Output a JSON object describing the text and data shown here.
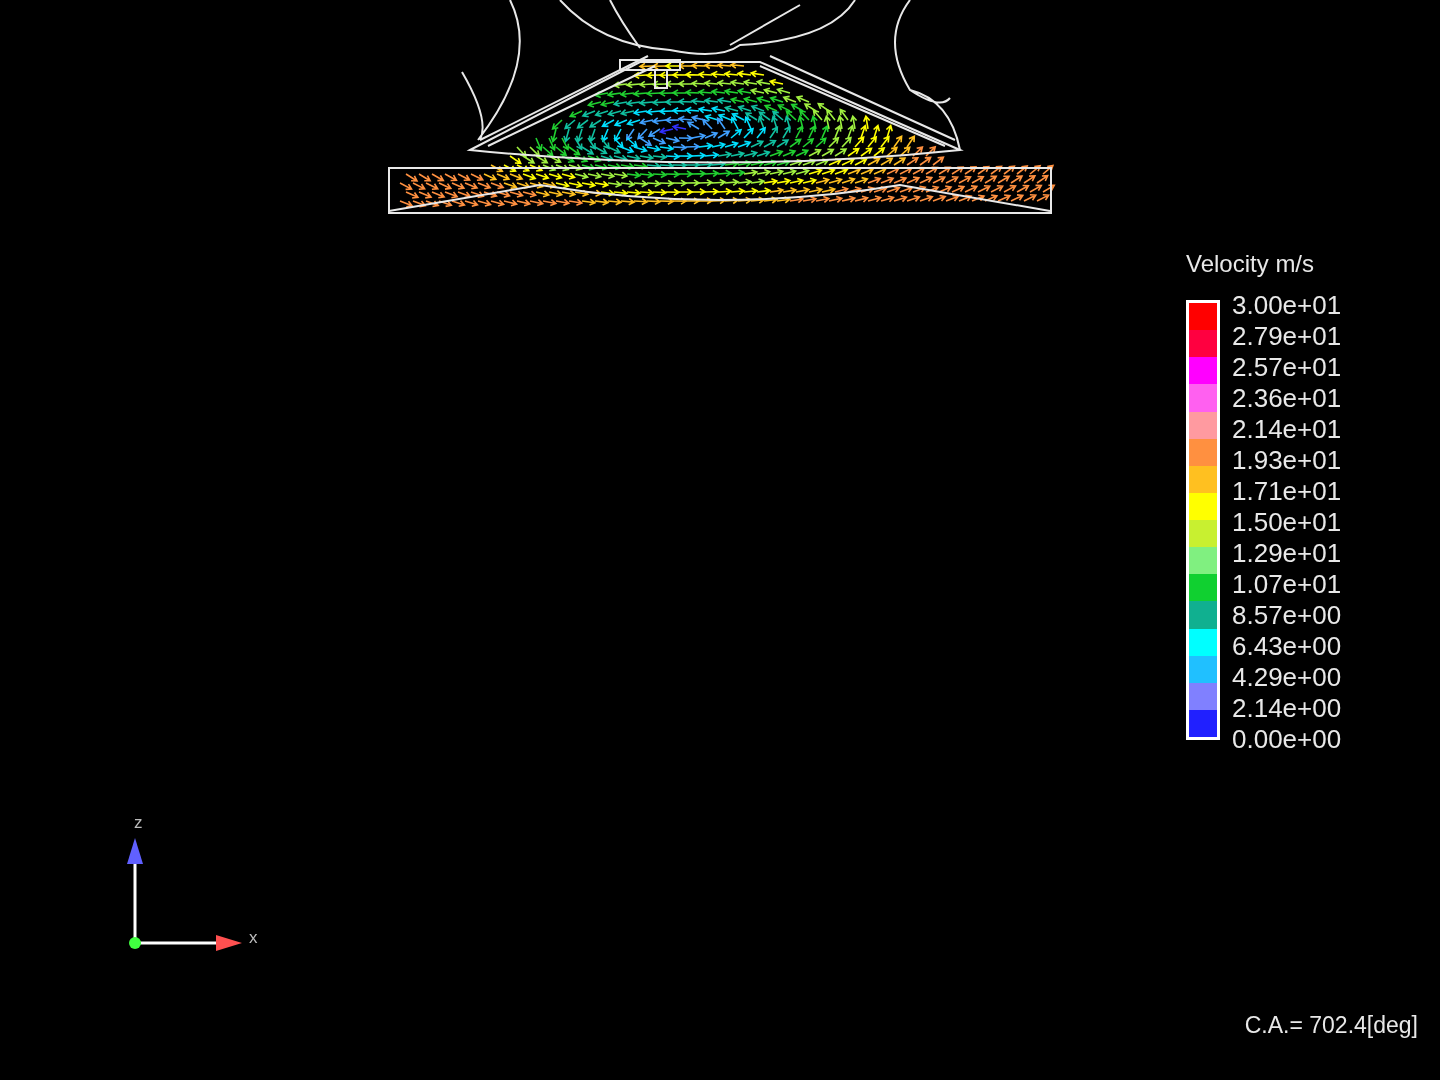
{
  "viewport": {
    "legend": {
      "title": "Velocity m/s",
      "labels": [
        "3.00e+01",
        "2.79e+01",
        "2.57e+01",
        "2.36e+01",
        "2.14e+01",
        "1.93e+01",
        "1.71e+01",
        "1.50e+01",
        "1.29e+01",
        "1.07e+01",
        "8.57e+00",
        "6.43e+00",
        "4.29e+00",
        "2.14e+00",
        "0.00e+00"
      ]
    },
    "triad": {
      "z_label": "z",
      "x_label": "x"
    },
    "crank_angle": "C.A.= 702.4[deg]"
  }
}
